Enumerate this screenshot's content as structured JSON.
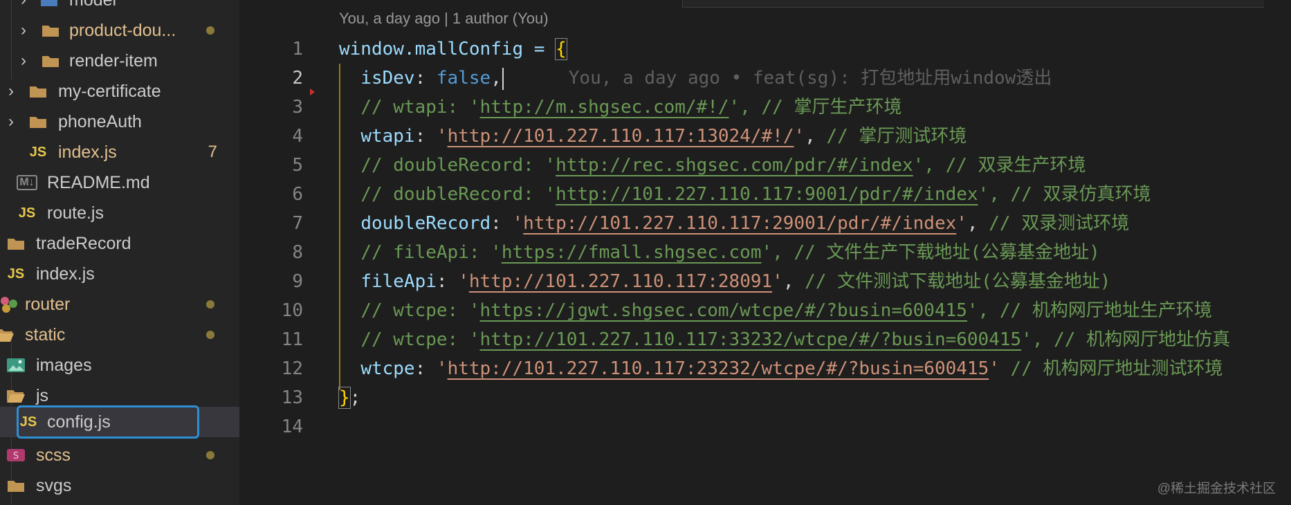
{
  "explorer": {
    "items": [
      {
        "label": "model",
        "type": "folder",
        "color": "#cccccc"
      },
      {
        "label": "product-dou...",
        "type": "folder",
        "color": "#e2c08d",
        "dot": "#8a7a3a"
      },
      {
        "label": "render-item",
        "type": "folder",
        "color": "#cccccc"
      },
      {
        "label": "my-certificate",
        "type": "folder",
        "color": "#cccccc"
      },
      {
        "label": "phoneAuth",
        "type": "folder",
        "color": "#cccccc"
      },
      {
        "label": "index.js",
        "type": "js",
        "color": "#e2c08d",
        "badge": "7",
        "icon": "JS"
      },
      {
        "label": "README.md",
        "type": "md",
        "color": "#cccccc",
        "icon": "M↓"
      },
      {
        "label": "route.js",
        "type": "js",
        "color": "#cccccc",
        "icon": "JS"
      },
      {
        "label": "tradeRecord",
        "type": "folder",
        "color": "#cccccc"
      },
      {
        "label": "index.js",
        "type": "js",
        "color": "#cccccc",
        "icon": "JS"
      },
      {
        "label": "router",
        "type": "router",
        "color": "#e2c08d",
        "dot": "#8a7a3a"
      },
      {
        "label": "static",
        "type": "folder-open",
        "color": "#e2c08d",
        "dot": "#8a7a3a"
      },
      {
        "label": "images",
        "type": "images",
        "color": "#cccccc"
      },
      {
        "label": "js",
        "type": "folder-open",
        "color": "#cccccc"
      },
      {
        "label": "config.js",
        "type": "js",
        "color": "#cccccc",
        "icon": "JS"
      },
      {
        "label": "scss",
        "type": "scss",
        "color": "#e2c08d",
        "dot": "#8a7a3a"
      },
      {
        "label": "svgs",
        "type": "folder",
        "color": "#cccccc"
      }
    ]
  },
  "editor": {
    "codelens": "You, a day ago | 1 author (You)",
    "blame": "You, a day ago • feat(sg): 打包地址用window透出",
    "line_numbers": [
      "1",
      "2",
      "3",
      "4",
      "5",
      "6",
      "7",
      "8",
      "9",
      "10",
      "11",
      "12",
      "13",
      "14"
    ],
    "active_line": "2",
    "lines": {
      "l1": {
        "a": "window.mallConfig = ",
        "b": "{"
      },
      "l2": {
        "key": "isDev",
        "colon": ": ",
        "val": "false",
        "tail": ","
      },
      "l3": {
        "pre": "// wtapi: '",
        "url": "http://m.shgsec.com/#!/",
        "post": "', // 掌厅生产环境"
      },
      "l4": {
        "key": "wtapi",
        "colon": ": ",
        "q1": "'",
        "url": "http://101.227.110.117:13024/#!/",
        "q2": "'",
        "comma": ", ",
        "comment": "// 掌厅测试环境"
      },
      "l5": {
        "pre": "// doubleRecord: '",
        "url": "http://rec.shgsec.com/pdr/#/index",
        "post": "', // 双录生产环境"
      },
      "l6": {
        "pre": "// doubleRecord: '",
        "url": "http://101.227.110.117:9001/pdr/#/index",
        "post": "', // 双录仿真环境"
      },
      "l7": {
        "key": "doubleRecord",
        "colon": ": ",
        "q1": "'",
        "url": "http://101.227.110.117:29001/pdr/#/index",
        "q2": "'",
        "comma": ", ",
        "comment": "// 双录测试环境"
      },
      "l8": {
        "pre": "// fileApi: '",
        "url": "https://fmall.shgsec.com",
        "post": "', // 文件生产下载地址(公募基金地址)"
      },
      "l9": {
        "key": "fileApi",
        "colon": ": ",
        "q1": "'",
        "url": "http://101.227.110.117:28091",
        "q2": "'",
        "comma": ", ",
        "comment": "// 文件测试下载地址(公募基金地址)"
      },
      "l10": {
        "pre": "// wtcpe: '",
        "url": "https://jgwt.shgsec.com/wtcpe/#/?busin=600415",
        "post": "', // 机构网厅地址生产环境"
      },
      "l11": {
        "pre": "// wtcpe: '",
        "url": "http://101.227.110.117:33232/wtcpe/#/?busin=600415",
        "post": "', // 机构网厅地址仿真"
      },
      "l12": {
        "key": "wtcpe",
        "colon": ": ",
        "q1": "'",
        "url": "http://101.227.110.117:23232/wtcpe/#/?busin=600415",
        "q2": "'",
        "comma": " ",
        "comment": "// 机构网厅地址测试环境"
      },
      "l13": {
        "a": "}",
        "b": ";"
      }
    }
  },
  "watermark": "@稀土掘金技术社区"
}
